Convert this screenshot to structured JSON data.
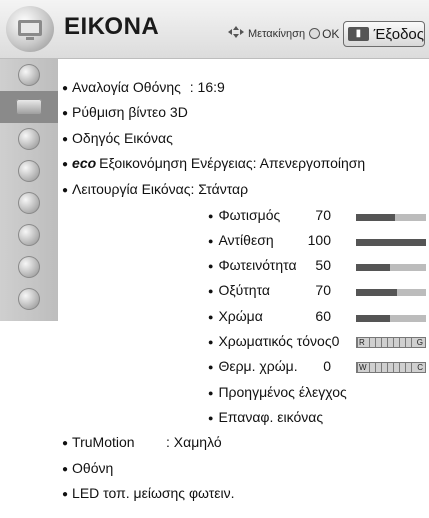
{
  "header": {
    "title": "ΕΙΚΟΝΑ",
    "nav_move": "Μετακίνηση",
    "nav_ok": "OK",
    "exit_label": "Έξοδος",
    "exit_icon": "exit-key-icon"
  },
  "sidebar": {
    "items": [
      {
        "icon": "settings-icon"
      },
      {
        "icon": "picture-icon"
      },
      {
        "icon": "audio-icon"
      },
      {
        "icon": "time-icon"
      },
      {
        "icon": "lock-icon"
      },
      {
        "icon": "option-icon"
      },
      {
        "icon": "network-icon"
      },
      {
        "icon": "support-icon"
      }
    ],
    "active_index": 1
  },
  "menu": {
    "aspect_label": "Αναλογία Οθόνης",
    "aspect_value": ": 16:9",
    "video3d_label": "Ρύθμιση βίντεο 3D",
    "guide_label": "Οδηγός Εικόνας",
    "eco_mark": "eco",
    "eco_label": "Εξοικονόμηση Ενέργειας: Απενεργοποίηση",
    "mode_label": "Λειτουργία Εικόνας",
    "mode_value": ": Στάνταρ",
    "backlight_label": "Φωτισμός",
    "backlight_value": "70",
    "backlight_level": 0.55,
    "contrast_label": "Αντίθεση",
    "contrast_value": "100",
    "contrast_level": 1.0,
    "brightness_label": "Φωτεινότητα",
    "brightness_value": "50",
    "brightness_level": 0.48,
    "sharpness_label": "Οξύτητα",
    "sharpness_value": "70",
    "sharpness_level": 0.58,
    "color_label": "Χρώμα",
    "color_value": "60",
    "color_level": 0.48,
    "tint_label": "Χρωματικός τόνος0",
    "tint_left": "R",
    "tint_right": "G",
    "temp_label": "Θερμ. χρώμ.",
    "temp_value": "0",
    "temp_left": "W",
    "temp_right": "C",
    "advanced_label": "Προηγμένος έλεγχος",
    "reset_label": "Επαναφ. εικόνας",
    "trumotion_label": "TruMotion",
    "trumotion_value": ": Χαμηλό",
    "screen_label": "Οθόνη",
    "led_label": "LED τοπ. μείωσης φωτειν."
  }
}
